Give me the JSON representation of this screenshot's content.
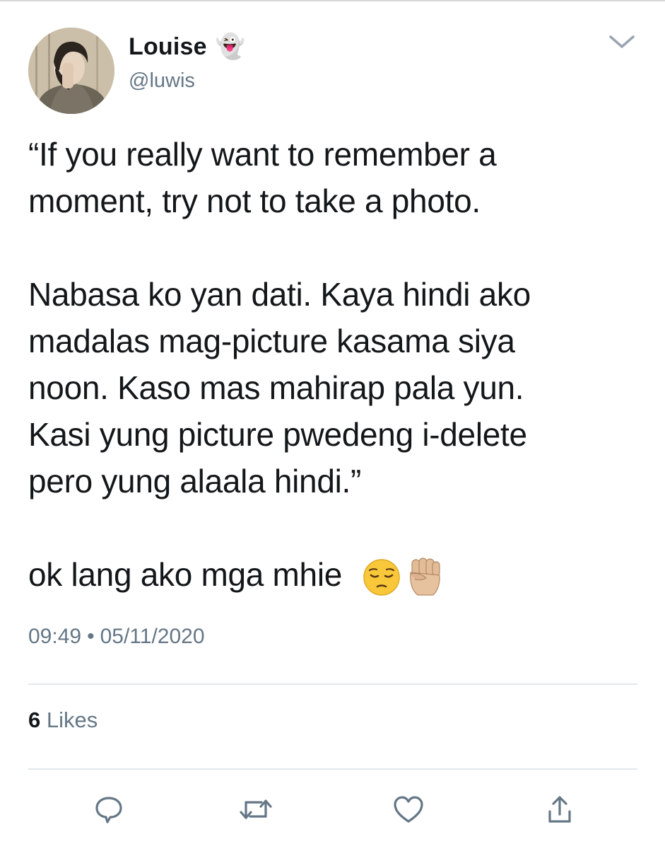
{
  "user": {
    "display_name": "Louise",
    "name_emoji": "👻",
    "handle": "@luwis"
  },
  "tweet": {
    "paragraphs": [
      [
        "“If you really want to remember a",
        "moment, try not to take a photo."
      ],
      [
        "Nabasa ko yan dati. Kaya hindi ako",
        "madalas mag-picture kasama siya",
        "noon. Kaso mas mahirap pala yun.",
        "Kasi yung picture pwedeng i-delete",
        "pero yung alaala hindi.”"
      ],
      [
        "ok lang ako mga mhie"
      ]
    ],
    "trailing_emojis": [
      "pensive-face-emoji",
      "raised-fist-emoji"
    ]
  },
  "meta": {
    "time": "09:49",
    "separator": "•",
    "date": "05/11/2020"
  },
  "stats": {
    "likes_count": "6",
    "likes_label": "Likes"
  },
  "actions": [
    "reply-icon",
    "retweet-icon",
    "like-icon",
    "share-icon"
  ],
  "colors": {
    "text": "#14171a",
    "secondary": "#657786",
    "divider": "#e1e8ed",
    "icon": "#657786"
  }
}
